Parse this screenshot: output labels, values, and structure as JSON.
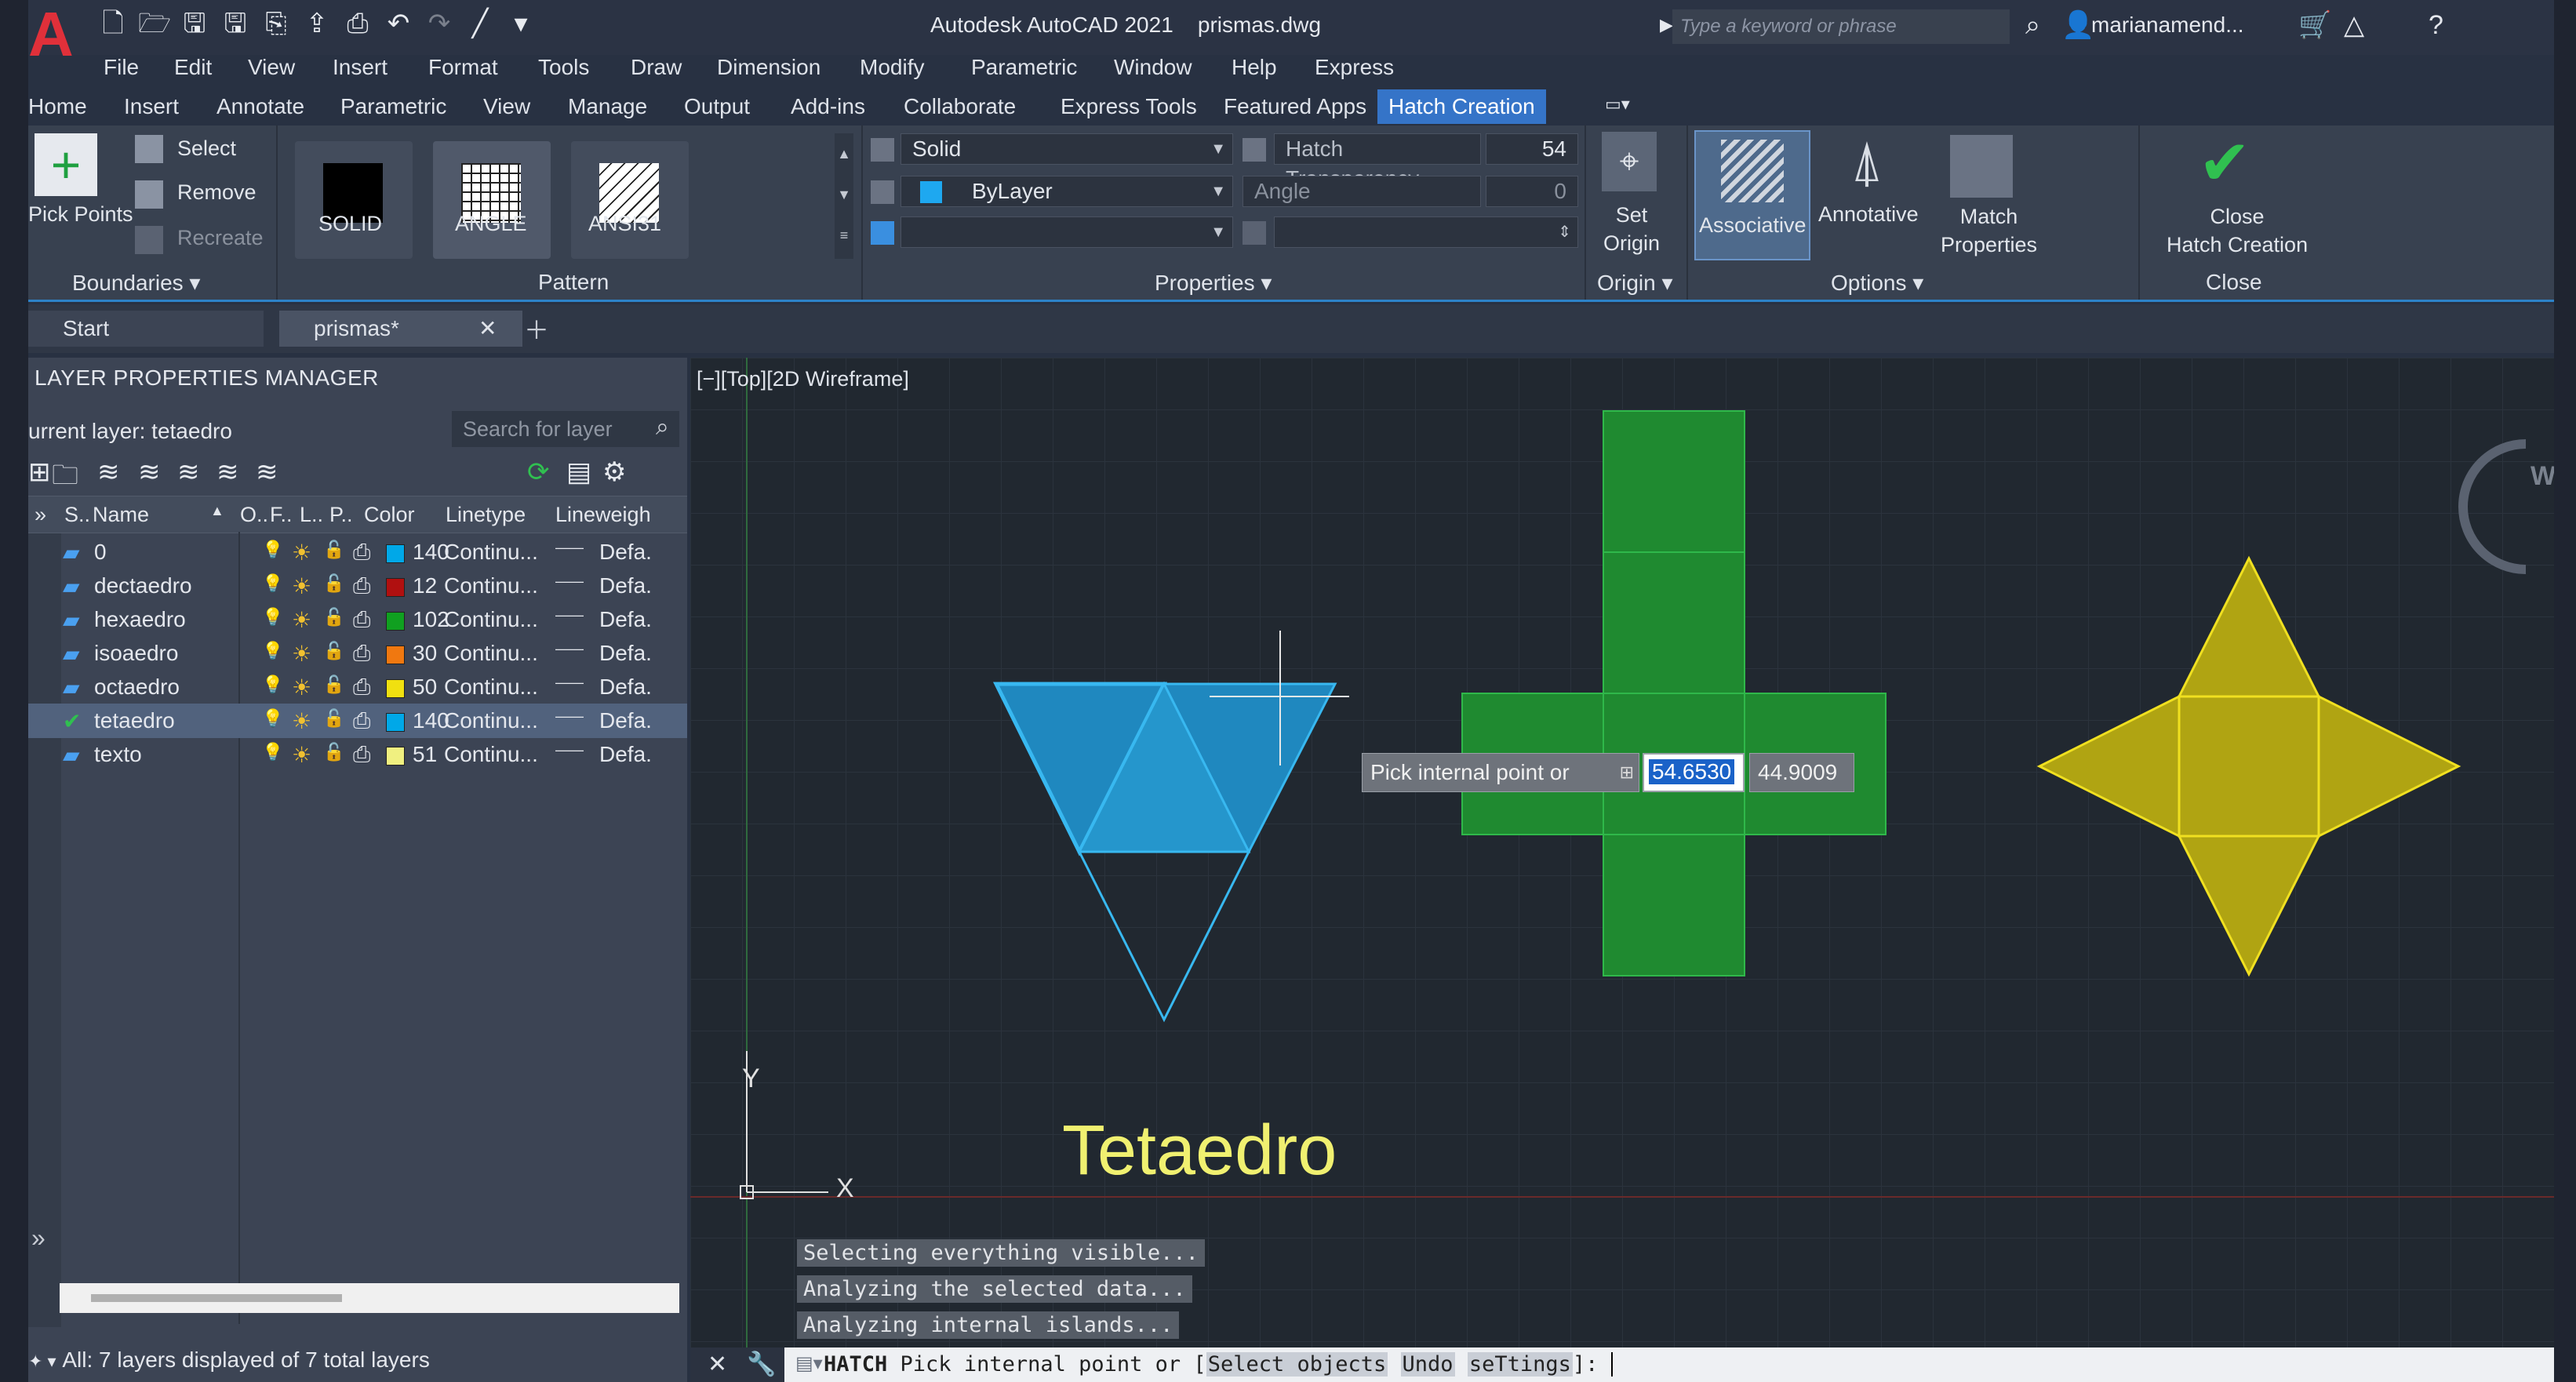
{
  "titlebar": {
    "app_name": "Autodesk AutoCAD 2021",
    "file_name": "prismas.dwg",
    "search_placeholder": "Type a keyword or phrase",
    "user": "marianamend...",
    "logo_letter": "A"
  },
  "menu": [
    "File",
    "Edit",
    "View",
    "Insert",
    "Format",
    "Tools",
    "Draw",
    "Dimension",
    "Modify",
    "Parametric",
    "Window",
    "Help",
    "Express"
  ],
  "ribbon_tabs": [
    "Home",
    "Insert",
    "Annotate",
    "Parametric",
    "View",
    "Manage",
    "Output",
    "Add-ins",
    "Collaborate",
    "Express Tools",
    "Featured Apps",
    "Hatch Creation"
  ],
  "active_ribbon_tab": "Hatch Creation",
  "ribbon": {
    "boundaries": {
      "pick_points": "Pick Points",
      "select": "Select",
      "remove": "Remove",
      "recreate": "Recreate",
      "title": "Boundaries"
    },
    "pattern": {
      "items": [
        "SOLID",
        "ANGLE",
        "ANSI31"
      ],
      "title": "Pattern"
    },
    "properties": {
      "type": "Solid",
      "color": "ByLayer",
      "transparency_label": "Hatch Transparency",
      "transparency_value": "54",
      "angle_label": "Angle",
      "angle_value": "0",
      "title": "Properties"
    },
    "origin": {
      "set_origin": "Set Origin",
      "title": "Origin"
    },
    "options": {
      "associative": "Associative",
      "annotative": "Annotative",
      "match_properties": "Match Properties",
      "title": "Options"
    },
    "close": {
      "close_hatch": "Close Hatch Creation",
      "title": "Close"
    }
  },
  "doc_tabs": {
    "start": "Start",
    "active": "prismas*"
  },
  "layer_manager": {
    "title": "LAYER PROPERTIES MANAGER",
    "current_layer": "urrent layer: tetaedro",
    "search_placeholder": "Search for layer",
    "headers": [
      "S..",
      "Name",
      "O..",
      "F..",
      "L..",
      "P..",
      "Color",
      "Linetype",
      "Lineweigh"
    ],
    "layers": [
      {
        "name": "0",
        "color_num": "140",
        "color_hex": "#00a8e8",
        "linetype": "Continu...",
        "lineweight": "Defa."
      },
      {
        "name": "dectaedro",
        "color_num": "12",
        "color_hex": "#b01010",
        "linetype": "Continu...",
        "lineweight": "Defa."
      },
      {
        "name": "hexaedro",
        "color_num": "102",
        "color_hex": "#10a020",
        "linetype": "Continu...",
        "lineweight": "Defa."
      },
      {
        "name": "isoaedro",
        "color_num": "30",
        "color_hex": "#f07810",
        "linetype": "Continu...",
        "lineweight": "Defa."
      },
      {
        "name": "octaedro",
        "color_num": "50",
        "color_hex": "#f0e010",
        "linetype": "Continu...",
        "lineweight": "Defa."
      },
      {
        "name": "tetaedro",
        "color_num": "140",
        "color_hex": "#00a8e8",
        "linetype": "Continu...",
        "lineweight": "Defa."
      },
      {
        "name": "texto",
        "color_num": "51",
        "color_hex": "#f0f080",
        "linetype": "Continu...",
        "lineweight": "Defa."
      }
    ],
    "selected_layer": "tetaedro",
    "status": "All: 7 layers displayed of 7 total layers"
  },
  "viewport": {
    "label": "[−][Top][2D Wireframe]",
    "compass_letter": "W",
    "tooltip_prompt": "Pick internal point or",
    "coord_x": "54.6530",
    "coord_y": "44.9009",
    "drawing_text": "Tetaedro",
    "axis_x": "X",
    "axis_y": "Y"
  },
  "history": [
    "Selecting everything visible...",
    "Analyzing the selected data...",
    "Analyzing internal islands..."
  ],
  "command": {
    "name": "HATCH",
    "prompt": "Pick internal point or [",
    "opt1": "Select objects",
    "opt2": "Undo",
    "opt3": "seTtings",
    "suffix": "]:"
  },
  "colors": {
    "accent": "#3574c8",
    "tetra_fill": "#1f88bf",
    "hexa_fill": "#1f8a30",
    "octa_fill": "#b0a412"
  }
}
